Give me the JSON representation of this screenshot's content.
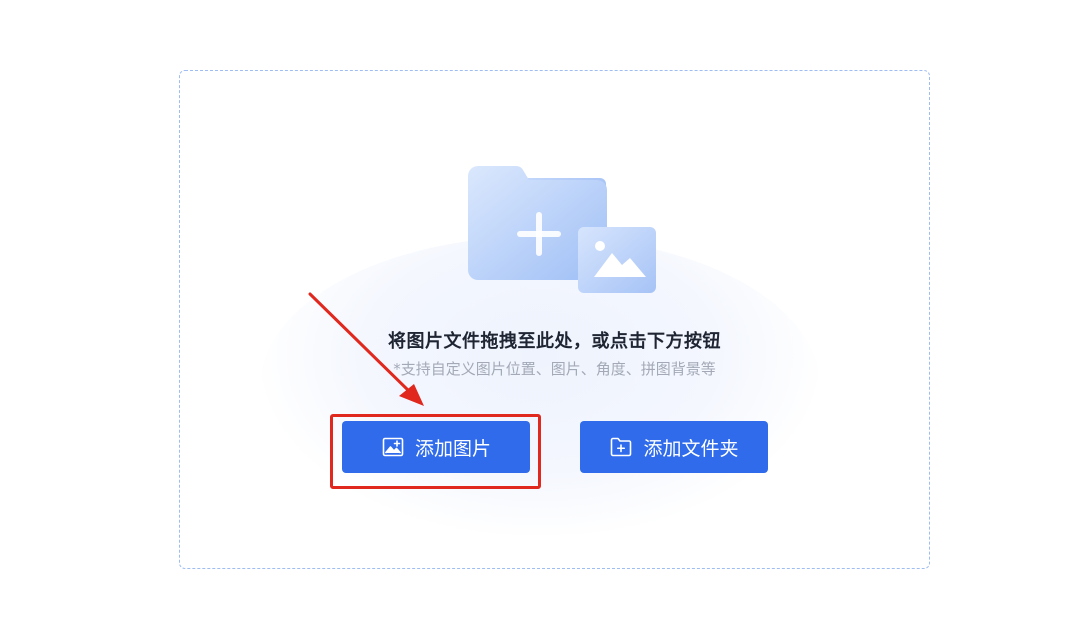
{
  "upload": {
    "title": "将图片文件拖拽至此处，或点击下方按钮",
    "subtitle": "*支持自定义图片位置、图片、角度、拼图背景等",
    "add_image_label": "添加图片",
    "add_folder_label": "添加文件夹"
  },
  "icons": {
    "illustration": "folder-plus-image-illustration",
    "add_image": "image-plus-icon",
    "add_folder": "folder-plus-icon"
  },
  "colors": {
    "accent": "#2f6bea",
    "dashed_border": "#9ebdf2",
    "annotation_red": "#e0281e"
  }
}
